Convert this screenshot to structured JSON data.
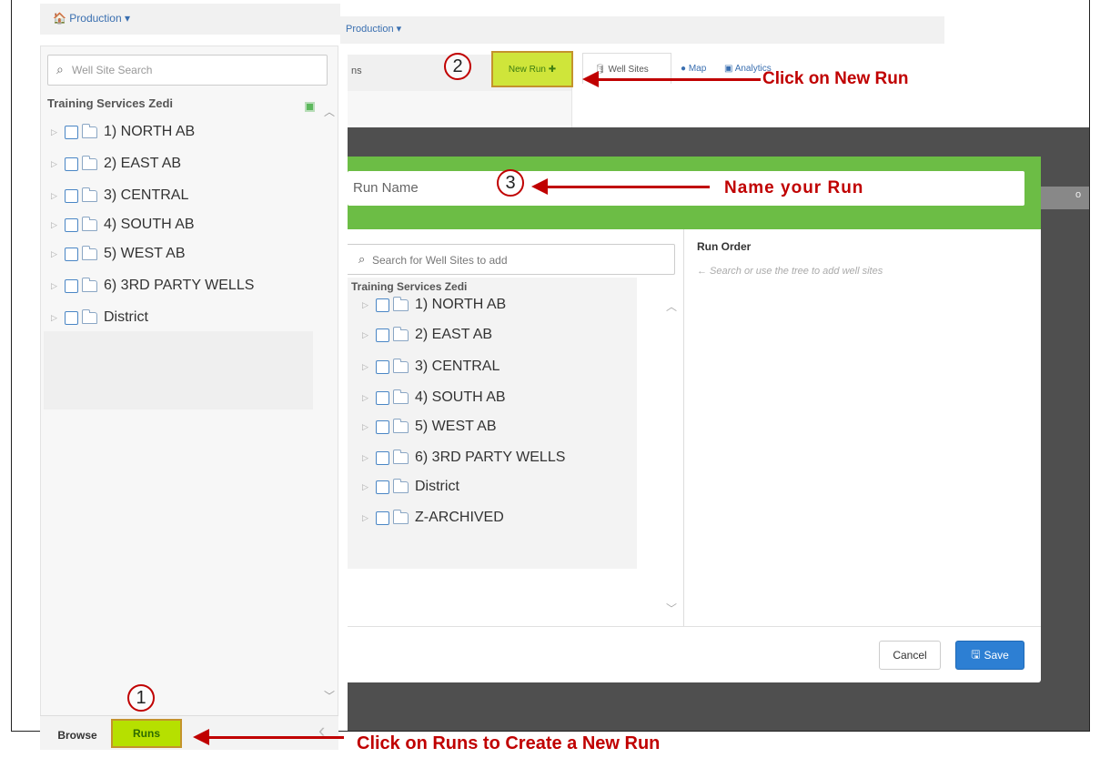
{
  "top_nav": {
    "left_dropdown": "🏠 Production ▾",
    "right_dropdown": "Production ▾"
  },
  "sidebar": {
    "search_placeholder": "Well Site Search",
    "tree_title": "Training Services Zedi",
    "items": [
      {
        "label": "1) NORTH AB"
      },
      {
        "label": "2) EAST AB"
      },
      {
        "label": "3) CENTRAL"
      },
      {
        "label": "4) SOUTH AB"
      },
      {
        "label": "5) WEST AB"
      },
      {
        "label": "6) 3RD PARTY WELLS"
      },
      {
        "label": "District"
      }
    ],
    "bottom_tabs": {
      "browse": "Browse",
      "runs": "Runs"
    }
  },
  "toolbar": {
    "runs_header_partial": "ns",
    "new_run_label": "New Run ✚",
    "tabs": {
      "well_sites": "Well Sites",
      "map": "Map",
      "analytics": "Analytics"
    }
  },
  "overlay_strip_text": "o",
  "modal": {
    "run_name_placeholder": "Run Name",
    "search_placeholder": "Search for Well Sites to add",
    "tree_title": "Training Services Zedi",
    "items": [
      {
        "label": "1) NORTH AB"
      },
      {
        "label": "2) EAST AB"
      },
      {
        "label": "3) CENTRAL"
      },
      {
        "label": "4) SOUTH AB"
      },
      {
        "label": "5) WEST AB"
      },
      {
        "label": "6) 3RD PARTY WELLS"
      },
      {
        "label": "District"
      },
      {
        "label": "Z-ARCHIVED"
      }
    ],
    "run_order_title": "Run Order",
    "run_order_hint": "← Search or use the tree to add well sites",
    "cancel_label": "Cancel",
    "save_label": "Save"
  },
  "annotations": {
    "step1": "1",
    "step2": "2",
    "step3": "3",
    "click_new_run": "Click on New Run",
    "name_run": "Name your Run",
    "click_runs": "Click on Runs to Create a New Run"
  },
  "colors": {
    "accent_green": "#6cbd45",
    "runs_tab_highlight": "#b6e000",
    "callout_red": "#c00000",
    "save_blue": "#2d7fd3"
  }
}
